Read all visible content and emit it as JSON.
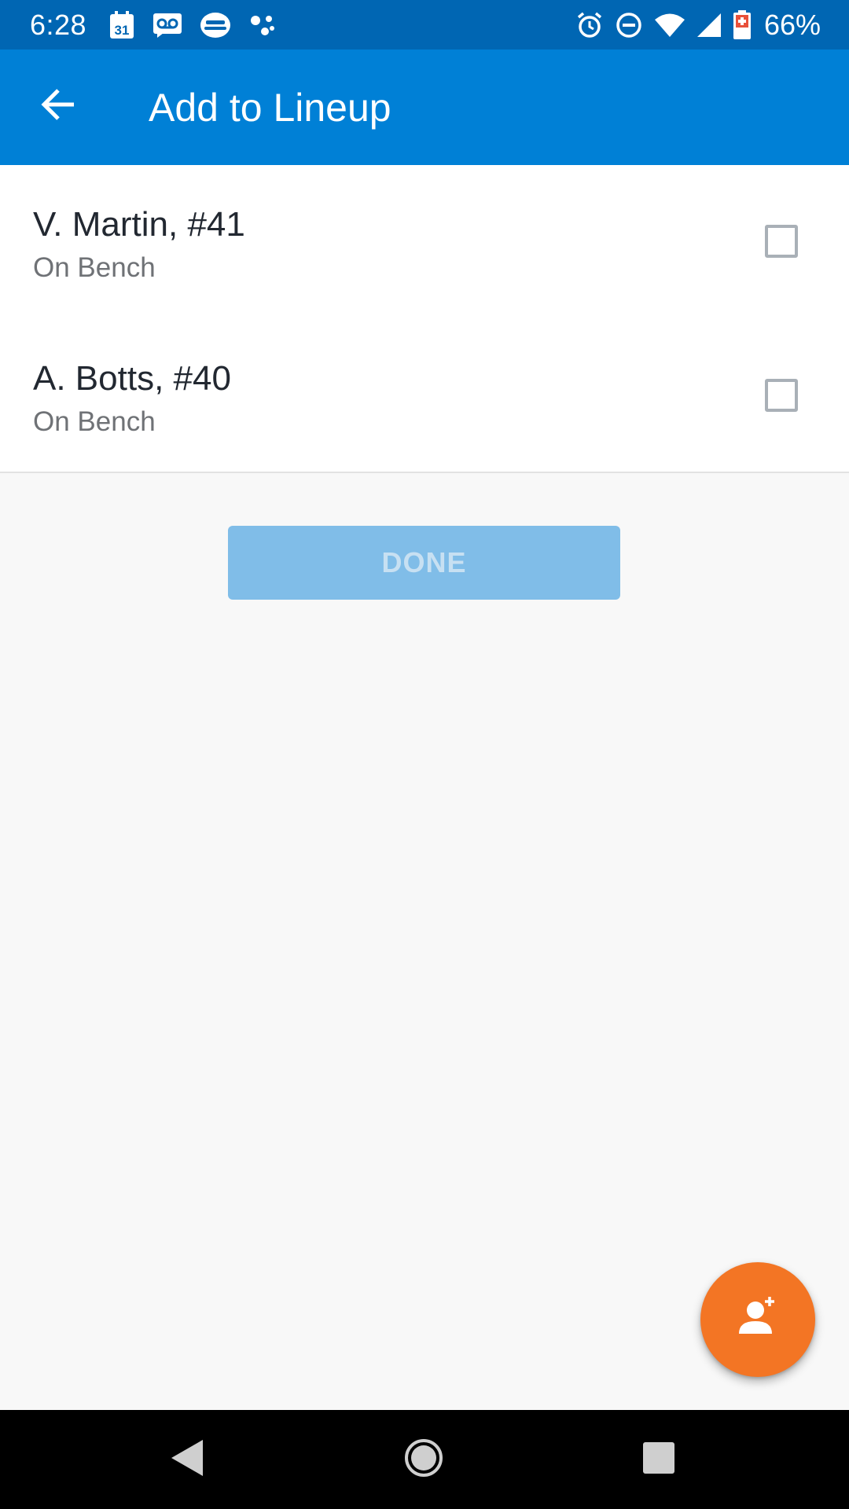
{
  "status_bar": {
    "time": "6:28",
    "battery_percent": "66%",
    "left_icons": [
      "calendar-icon",
      "voicemail-icon",
      "car-icon",
      "dots-icon"
    ],
    "right_icons": [
      "alarm-icon",
      "do-not-disturb-icon",
      "wifi-icon",
      "signal-icon",
      "battery-icon"
    ],
    "calendar_day": "31"
  },
  "app_bar": {
    "title": "Add to Lineup",
    "back_icon": "arrow-left-icon",
    "background_color": "#0080d6"
  },
  "players": [
    {
      "name": "V. Martin, #41",
      "status": "On Bench",
      "checked": false
    },
    {
      "name": "A. Botts, #40",
      "status": "On Bench",
      "checked": false
    }
  ],
  "done_button": {
    "label": "DONE",
    "enabled": false
  },
  "fab": {
    "icon": "add-person-icon",
    "color": "#f37524"
  },
  "nav_bar": {
    "buttons": [
      "back-triangle-icon",
      "home-circle-icon",
      "recents-square-icon"
    ]
  }
}
